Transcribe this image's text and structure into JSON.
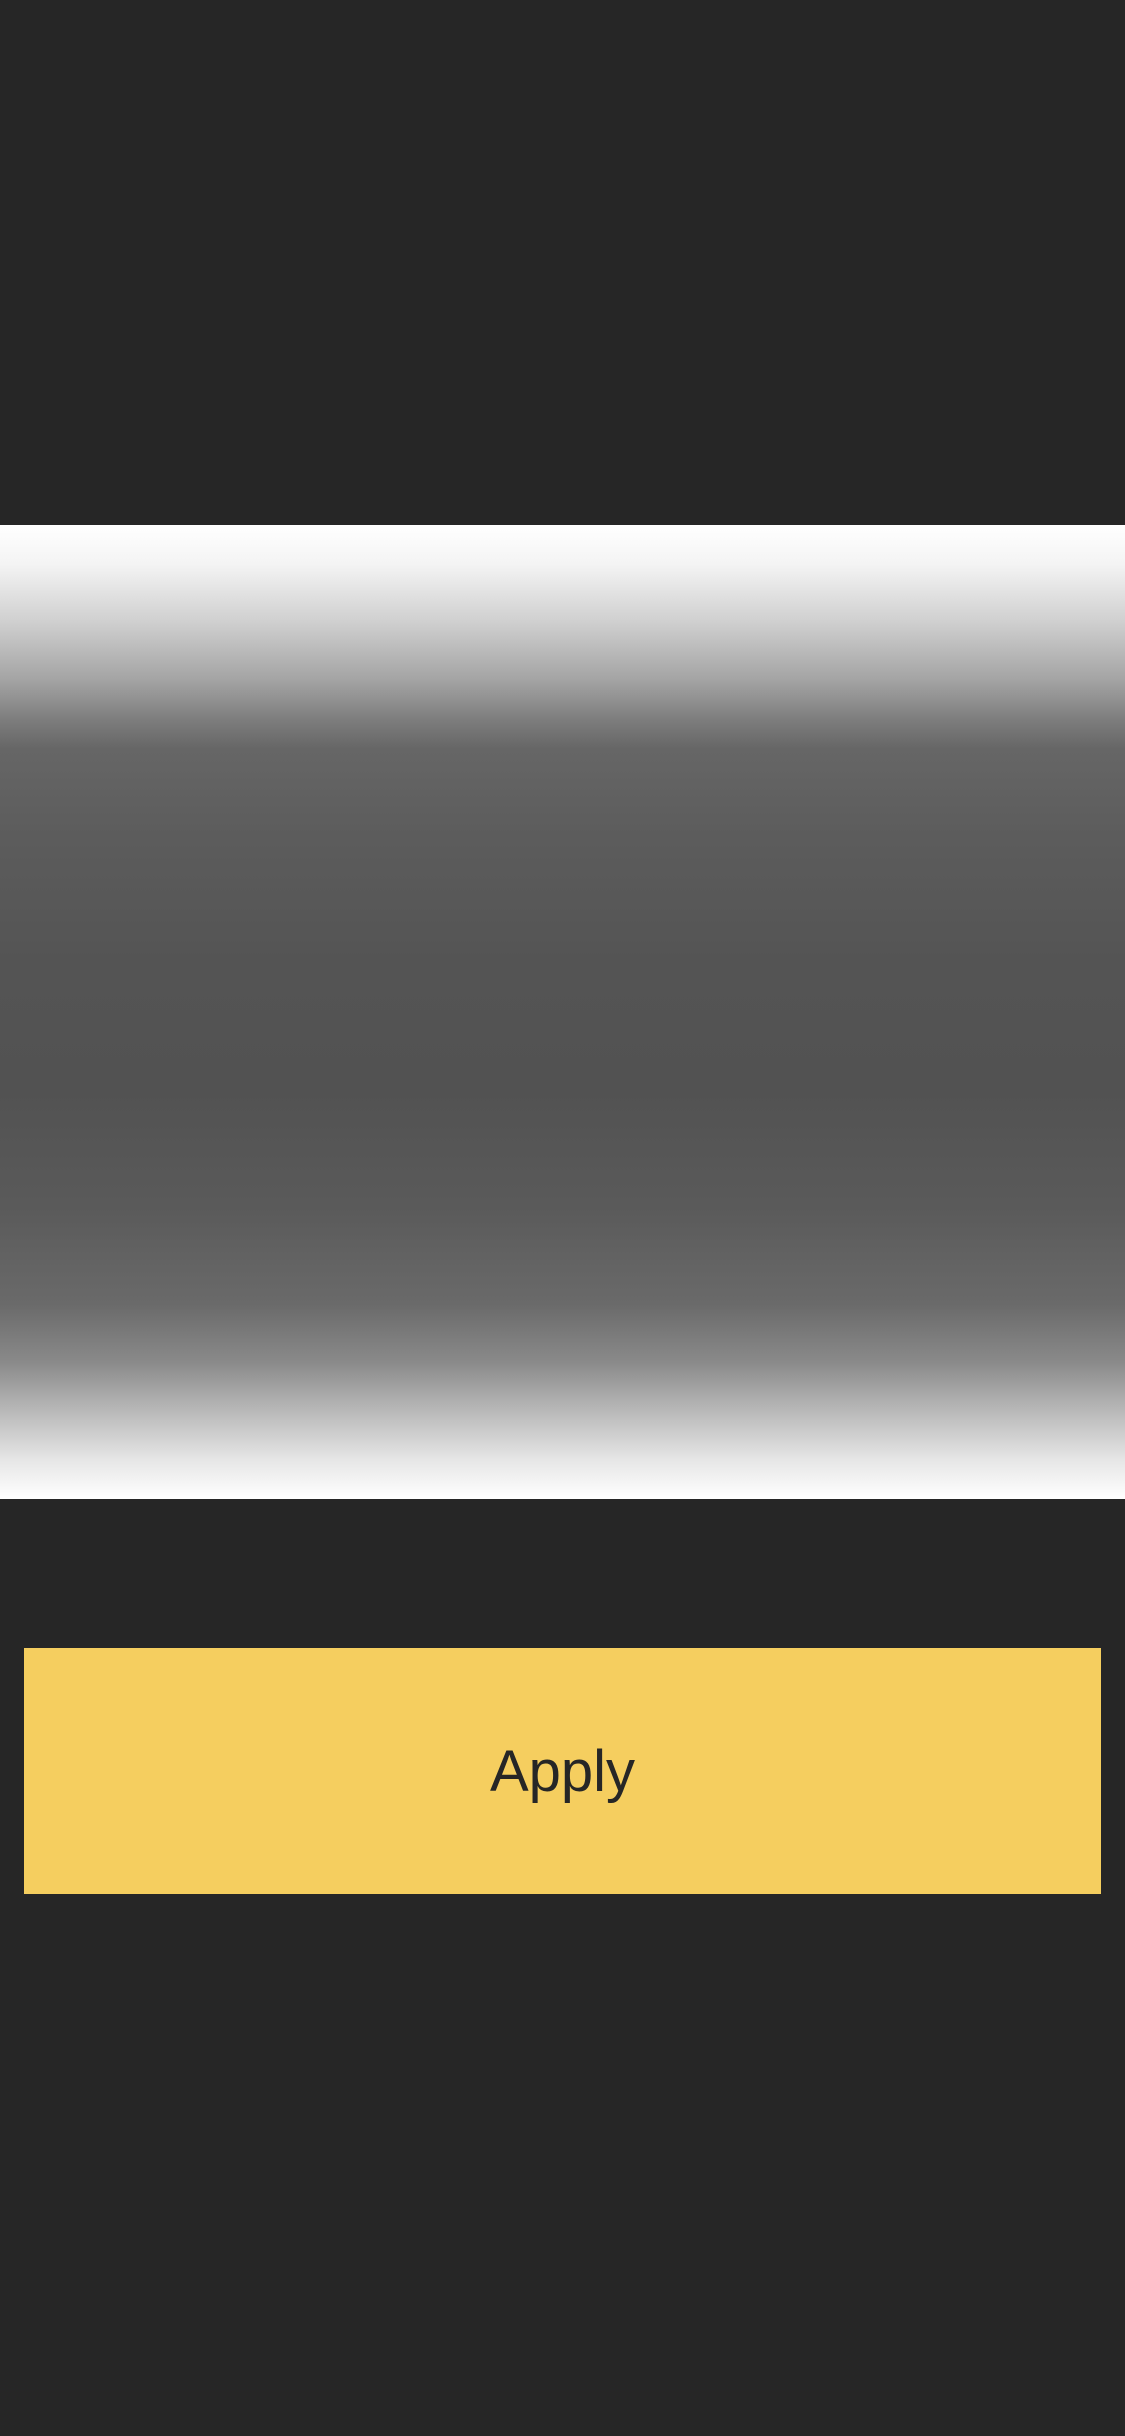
{
  "screen": {
    "background_color": "#262626",
    "gradient_panel_top_color": "#ffffff",
    "gradient_panel_mid_color": "#525252"
  },
  "apply_button": {
    "label": "Apply",
    "background_color": "#f5ce5f",
    "text_color": "#262626"
  }
}
